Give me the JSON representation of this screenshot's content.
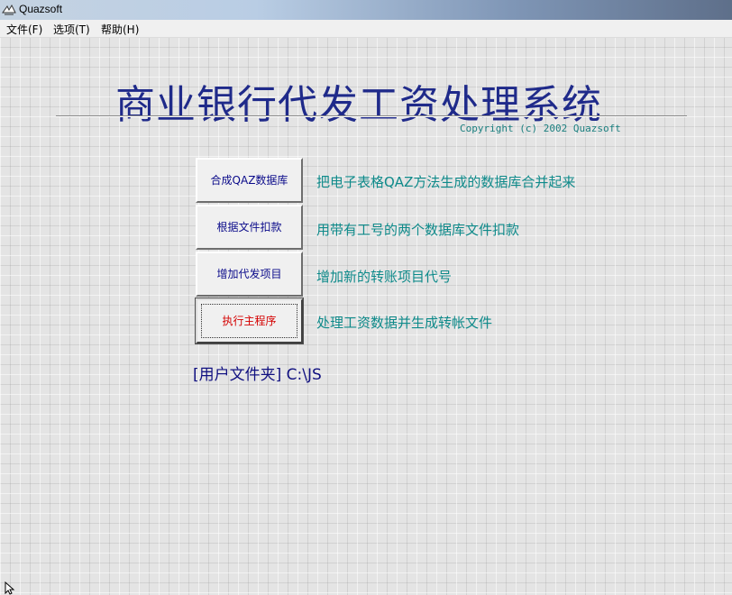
{
  "window": {
    "title": "Quazsoft",
    "icon": "quazsoft-app-icon"
  },
  "menu": {
    "file": "文件(F)",
    "options": "选项(T)",
    "help": "帮助(H)"
  },
  "header": {
    "title": "商业银行代发工资处理系统",
    "copyright": "Copyright (c) 2002 Quazsoft"
  },
  "actions": [
    {
      "label": "合成QAZ数据库",
      "description": "把电子表格QAZ方法生成的数据库合并起来"
    },
    {
      "label": "根据文件扣款",
      "description": "用带有工号的两个数据库文件扣款"
    },
    {
      "label": "增加代发项目",
      "description": "增加新的转账项目代号"
    },
    {
      "label": "执行主程序",
      "description": "处理工资数据并生成转帐文件"
    }
  ],
  "user_folder": {
    "text": "[用户文件夹] C:\\JS"
  },
  "colors": {
    "title": "#1f2a8a",
    "description": "#0e8a8a",
    "button_text": "#0b0b8a",
    "focused_button_text": "#d40000"
  }
}
